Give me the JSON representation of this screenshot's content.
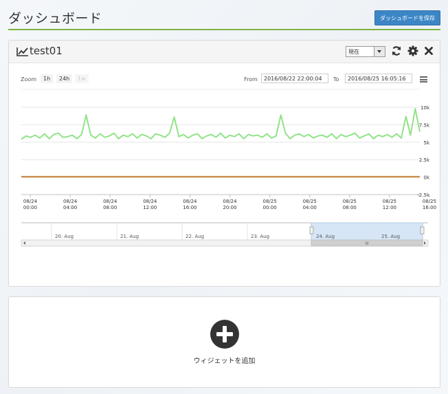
{
  "page": {
    "title": "ダッシュボード",
    "save_button": "ダッシュボードを保存"
  },
  "widget": {
    "title": "test01",
    "icon": "line-chart-icon",
    "period_select": {
      "value": "現在"
    },
    "actions": [
      "refresh-icon",
      "gear-icon",
      "close-icon"
    ]
  },
  "chart_toolbar": {
    "zoom_label": "Zoom",
    "zoom_buttons": [
      "1h",
      "24h",
      "1w"
    ],
    "from_label": "From",
    "from_value": "2016/08/22 22:00:04",
    "to_label": "To",
    "to_value": "2016/08/25 16:05:16"
  },
  "chart_data": {
    "type": "line",
    "x_range": [
      "2016-08-24 00:00",
      "2016-08-25 16:00"
    ],
    "ylim": [
      -2.5,
      10
    ],
    "y_ticks": [
      "10k",
      "7.5k",
      "5k",
      "2.5k",
      "0k",
      "-2.5k"
    ],
    "x_tick_labels": [
      [
        "08/24",
        "00:00"
      ],
      [
        "08/24",
        "04:00"
      ],
      [
        "08/24",
        "08:00"
      ],
      [
        "08/24",
        "12:00"
      ],
      [
        "08/24",
        "16:00"
      ],
      [
        "08/24",
        "20:00"
      ],
      [
        "08/25",
        "00:00"
      ],
      [
        "08/25",
        "04:00"
      ],
      [
        "08/25",
        "08:00"
      ],
      [
        "08/25",
        "12:00"
      ],
      [
        "08/25",
        "16:00"
      ]
    ],
    "grid": true,
    "series": [
      {
        "color": "#90e388",
        "values": [
          5.4,
          5.9,
          5.7,
          6.0,
          5.6,
          6.2,
          5.5,
          6.1,
          6.3,
          5.7,
          5.8,
          6.0,
          5.5,
          6.1,
          8.9,
          6.0,
          5.6,
          6.2,
          5.7,
          5.9,
          6.3,
          5.5,
          6.0,
          5.8,
          6.2,
          5.6,
          6.1,
          5.9,
          5.5,
          6.2,
          6.0,
          5.7,
          6.3,
          8.6,
          5.8,
          6.1,
          5.6,
          6.0,
          6.2,
          5.5,
          5.9,
          6.1,
          5.7,
          6.3,
          5.6,
          6.0,
          5.8,
          6.2,
          5.5,
          6.1,
          5.9,
          6.0,
          5.7,
          6.2,
          5.6,
          5.9,
          8.9,
          6.3,
          5.5,
          6.0,
          6.2,
          5.8,
          6.1,
          5.6,
          5.9,
          6.0,
          5.7,
          6.2,
          5.5,
          6.1,
          5.8,
          6.0,
          6.3,
          5.6,
          5.9,
          6.2,
          5.5,
          6.0,
          5.8,
          6.1,
          5.7,
          6.2,
          5.6,
          8.7,
          6.0,
          9.8,
          6.5
        ]
      },
      {
        "color": "#c98a4a",
        "values": [
          0.05,
          0.05,
          0.05,
          0.05,
          0.05,
          0.05,
          0.05,
          0.05,
          0.05,
          0.05,
          0.05,
          0.05,
          0.05,
          0.05,
          0.05,
          0.05,
          0.05,
          0.05,
          0.05,
          0.05,
          0.05,
          0.05,
          0.05,
          0.05,
          0.05,
          0.05,
          0.05,
          0.05,
          0.05,
          0.05
        ]
      }
    ]
  },
  "navigator": {
    "labels": [
      "20. Aug",
      "21. Aug",
      "22. Aug",
      "23. Aug",
      "24. Aug",
      "25. Aug"
    ],
    "scroll_grip": "III"
  },
  "add_widget": {
    "label": "ウィジェットを追加"
  }
}
